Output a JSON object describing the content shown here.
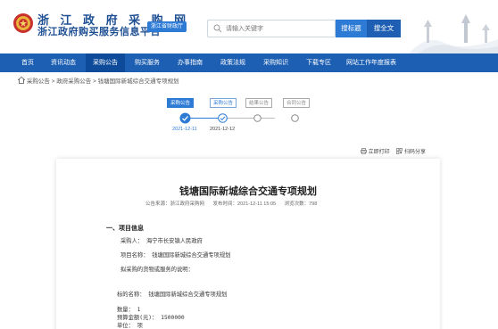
{
  "header": {
    "site_title_line1": "浙 江 政 府 采 购 网",
    "site_title_line2": "浙江政府购买服务信息平台",
    "region_badge": "浙江省财政厅",
    "search_placeholder": "请输入关键字",
    "search_button": "搜标题",
    "search_all_button": "搜全文"
  },
  "nav": {
    "items": [
      "首页",
      "资讯动态",
      "采购公告",
      "购买服务",
      "办事指南",
      "政策法规",
      "采购知识",
      "下载专区",
      "网站工作年度报表"
    ],
    "active_index": 2
  },
  "breadcrumb": {
    "items": [
      "采购公告",
      "政府采购公告",
      "钱塘国际新城综合交通专项规划"
    ],
    "separator": ">"
  },
  "progress": {
    "steps": [
      "采购公告",
      "采购公告",
      "结果公告",
      "合同公告"
    ],
    "completed_count": 2,
    "dates": [
      "2021-12-11",
      "2021-12-12"
    ]
  },
  "tools": {
    "print": "立即打印",
    "share": "扫码分享"
  },
  "article": {
    "title": "钱塘国际新城综合交通专项规划",
    "source": "公告来源：浙江政府采购网",
    "publish_time": "发布时间：2021-12-11 15:05",
    "views": "浏览次数：798",
    "section_title": "一、项目信息",
    "purchaser": "采购人：  海宁市长安镇人民政府",
    "project_name": "项目名称：  钱塘国际新城综合交通专项规划",
    "goods_desc": "拟采购的货物或服务的说明：",
    "item_name": "标的名称：         钱塘国际新城综合交通专项规划",
    "quantity": "数量：  1",
    "budget": "预算金额(元)：  1500000",
    "unit": "单位：  项"
  },
  "colors": {
    "nav_bg": "#1d5fb2",
    "nav_active": "#0d4a9a",
    "accent": "#2e7bd6",
    "title_blue": "#1e4f93"
  }
}
